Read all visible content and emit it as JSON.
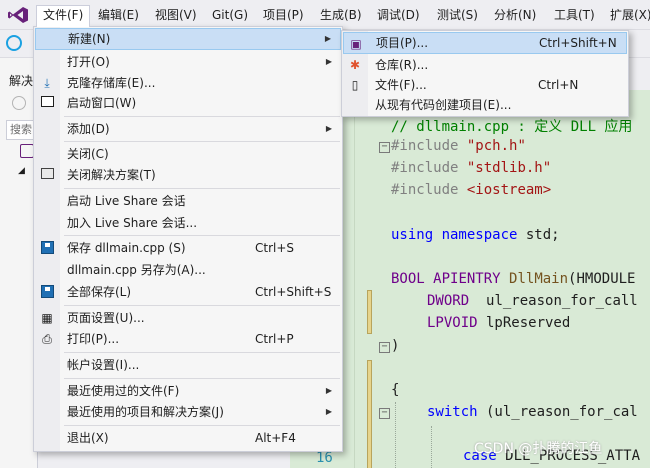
{
  "menubar": {
    "items": [
      {
        "label": "文件(F)",
        "active": true
      },
      {
        "label": "编辑(E)"
      },
      {
        "label": "视图(V)"
      },
      {
        "label": "Git(G)"
      },
      {
        "label": "项目(P)"
      },
      {
        "label": "生成(B)"
      },
      {
        "label": "调试(D)"
      },
      {
        "label": "测试(S)"
      },
      {
        "label": "分析(N)"
      },
      {
        "label": "工具(T)"
      },
      {
        "label": "扩展(X)"
      }
    ]
  },
  "left_pane": {
    "title": "解决",
    "search_placeholder": "搜索"
  },
  "file_menu": {
    "items": [
      {
        "label": "新建(N)",
        "submenu": true,
        "icon": "none"
      },
      {
        "label": "打开(O)",
        "submenu": true,
        "icon": "none"
      },
      {
        "label": "克隆存储库(E)...",
        "icon": "download-icon"
      },
      {
        "label": "启动窗口(W)",
        "icon": "start-window-icon"
      },
      {
        "label": "添加(D)",
        "submenu": true
      },
      {
        "label": "关闭(C)"
      },
      {
        "label": "关闭解决方案(T)",
        "icon": "close-solution-icon"
      },
      {
        "label": "启动 Live Share 会话"
      },
      {
        "label": "加入 Live Share 会话..."
      },
      {
        "label": "保存 dllmain.cpp (S)",
        "shortcut": "Ctrl+S",
        "icon": "save-icon"
      },
      {
        "label": "dllmain.cpp 另存为(A)..."
      },
      {
        "label": "全部保存(L)",
        "shortcut": "Ctrl+Shift+S",
        "icon": "save-all-icon"
      },
      {
        "label": "页面设置(U)...",
        "icon": "page-setup-icon"
      },
      {
        "label": "打印(P)...",
        "shortcut": "Ctrl+P",
        "icon": "print-icon"
      },
      {
        "label": "帐户设置(I)..."
      },
      {
        "label": "最近使用过的文件(F)",
        "submenu": true
      },
      {
        "label": "最近使用的项目和解决方案(J)",
        "submenu": true
      },
      {
        "label": "退出(X)",
        "shortcut": "Alt+F4"
      }
    ]
  },
  "new_menu": {
    "items": [
      {
        "label": "项目(P)...",
        "shortcut": "Ctrl+Shift+N",
        "icon": "project-icon",
        "highlighted": true
      },
      {
        "label": "仓库(R)...",
        "icon": "repository-icon"
      },
      {
        "label": "文件(F)...",
        "shortcut": "Ctrl+N",
        "icon": "file-icon"
      },
      {
        "label": "从现有代码创建项目(E)..."
      }
    ]
  },
  "editor": {
    "comment_line": "// dllmain.cpp : 定义 DLL 应用",
    "include1_kw": "#include",
    "include1_val": "\"pch.h\"",
    "include2_kw": "#include",
    "include2_val": "\"stdlib.h\"",
    "include3_kw": "#include",
    "include3_val": "<iostream>",
    "using_kw": "using namespace",
    "using_rest": " std;",
    "bool_type": "BOOL",
    "apientry": "APIENTRY",
    "dllmain": "DllMain",
    "dllmain_rest": "(HMODULE",
    "dword_type": "DWORD",
    "dword_rest": "ul_reason_for_call",
    "lpvoid_type": "LPVOID",
    "lpvoid_rest": " lpReserved",
    "close_paren": ")",
    "open_brace": "{",
    "switch_kw": "switch",
    "switch_rest": " (ul_reason_for_cal",
    "case_kw": "case",
    "case_rest": " DLL_PROCESS_ATTA",
    "line_number": "16"
  },
  "watermark": "CSDN @扑腾的江鱼"
}
